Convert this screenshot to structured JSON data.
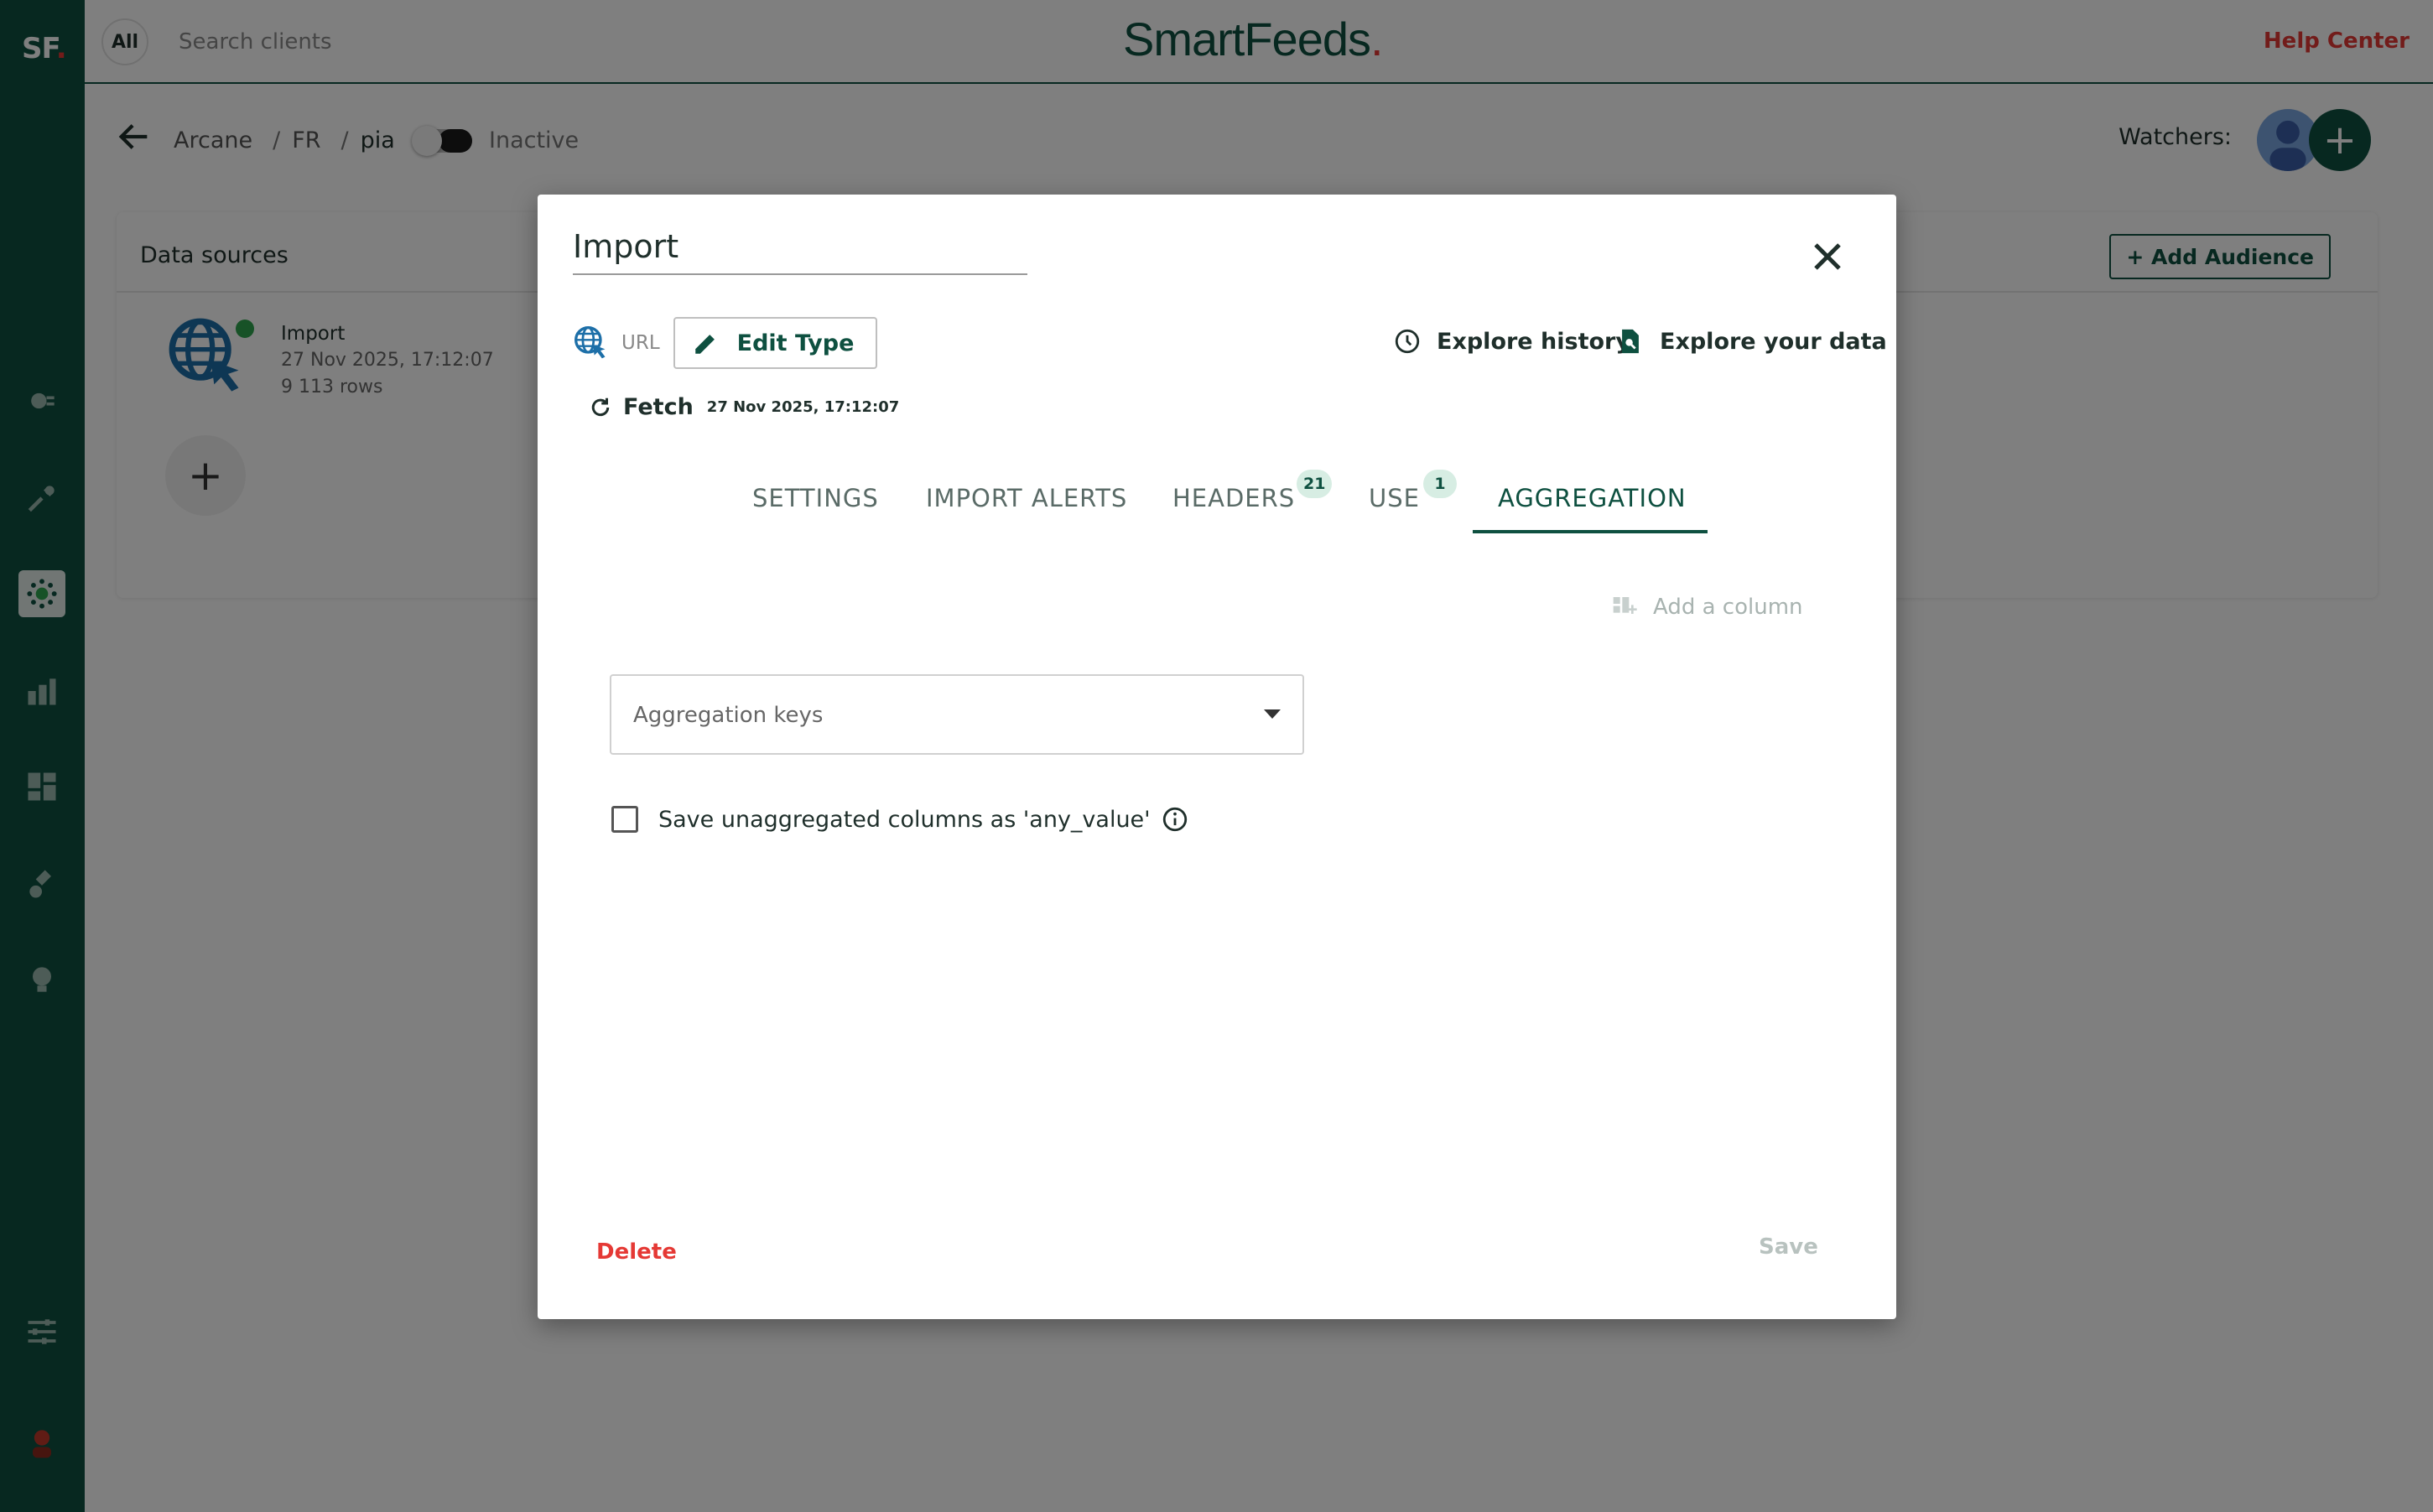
{
  "sidebar": {
    "logo": "SF",
    "logo_dot": ".",
    "icons": [
      "plugin-icon",
      "tools-icon",
      "network-icon",
      "chart-icon",
      "dashboard-icon",
      "brush-icon",
      "lightbulb-icon",
      "settings-sliders-icon",
      "user-avatar-icon"
    ],
    "active_icon": "network-icon"
  },
  "topbar": {
    "all_label": "All",
    "search_placeholder": "Search clients",
    "brand": "SmartFeeds",
    "brand_dot": ".",
    "help_center": "Help Center"
  },
  "breadcrumb": {
    "items": [
      "Arcane",
      "FR",
      "pia"
    ],
    "separator": "/",
    "status": "Inactive",
    "watchers_label": "Watchers:"
  },
  "panel": {
    "title": "Data sources",
    "add_audience": "+ Add Audience",
    "import": {
      "name": "Import",
      "date": "27 Nov 2025, 17:12:07",
      "rows": "9 113 rows"
    },
    "add_source": "+"
  },
  "modal": {
    "title": "Import",
    "url_label": "URL",
    "edit_type": "Edit Type",
    "explore_history": "Explore history",
    "explore_data": "Explore your data",
    "fetch_label": "Fetch",
    "fetch_date": "27 Nov 2025, 17:12:07",
    "tabs": [
      {
        "label": "SETTINGS"
      },
      {
        "label": "IMPORT ALERTS"
      },
      {
        "label": "HEADERS",
        "badge": "21"
      },
      {
        "label": "USE",
        "badge": "1"
      },
      {
        "label": "AGGREGATION"
      }
    ],
    "active_tab": "AGGREGATION",
    "add_column": "Add a column",
    "aggregation_placeholder": "Aggregation keys",
    "checkbox_label": "Save unaggregated columns as 'any_value'",
    "checkbox_checked": false,
    "delete": "Delete",
    "save": "Save"
  },
  "colors": {
    "primary": "#0e5040",
    "danger": "#e53935",
    "badge_bg": "#d7ede3",
    "disabled": "#b8c2bf"
  }
}
